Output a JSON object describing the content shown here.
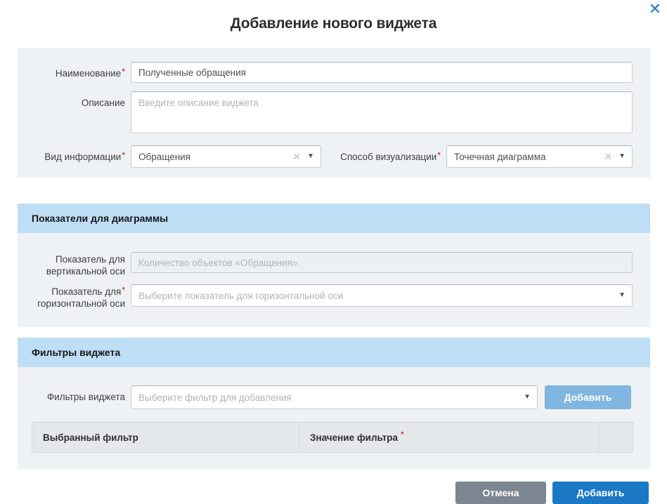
{
  "meta": {
    "required_marker": "*",
    "colors": {
      "accent_blue": "#1a78c5",
      "section_header_bg": "#bedef5",
      "panel_bg": "#eff2f5",
      "required_red": "#cc0000",
      "cancel_gray": "#7c8691",
      "add_filter_blue": "#80b6e0",
      "table_header_bg": "#e4e8eb"
    }
  },
  "icons": {
    "close": "✕",
    "clear": "✕",
    "caret": "▼"
  },
  "dialog": {
    "title": "Добавление нового виджета"
  },
  "main_form": {
    "name": {
      "label": "Наименование",
      "value": "Полученные обращения"
    },
    "description": {
      "label": "Описание",
      "placeholder": "Введите описание виджета"
    },
    "info_type": {
      "label": "Вид информации",
      "value": "Обращения"
    },
    "visualization": {
      "label": "Способ визуализации",
      "value": "Точечная диаграмма"
    }
  },
  "indicators": {
    "header": "Показатели для диаграммы",
    "vertical_axis": {
      "label_line1": "Показатель для",
      "label_line2": "вертикальной оси",
      "placeholder": "Количество объектов «Обращения»"
    },
    "horizontal_axis": {
      "label_line1": "Показатель для",
      "label_line2": "горизонтальной оси",
      "placeholder": "Выберите показатель для горизонтальной оси"
    }
  },
  "filters": {
    "header": "Фильтры виджета",
    "select": {
      "label": "Фильтры виджета",
      "placeholder": "Выберите фильтр для добавления"
    },
    "add_button_label": "Добавить",
    "table": {
      "col_filter": "Выбранный фильтр",
      "col_value": "Значение фильтра"
    }
  },
  "footer": {
    "cancel_label": "Отмена",
    "submit_label": "Добавить"
  }
}
